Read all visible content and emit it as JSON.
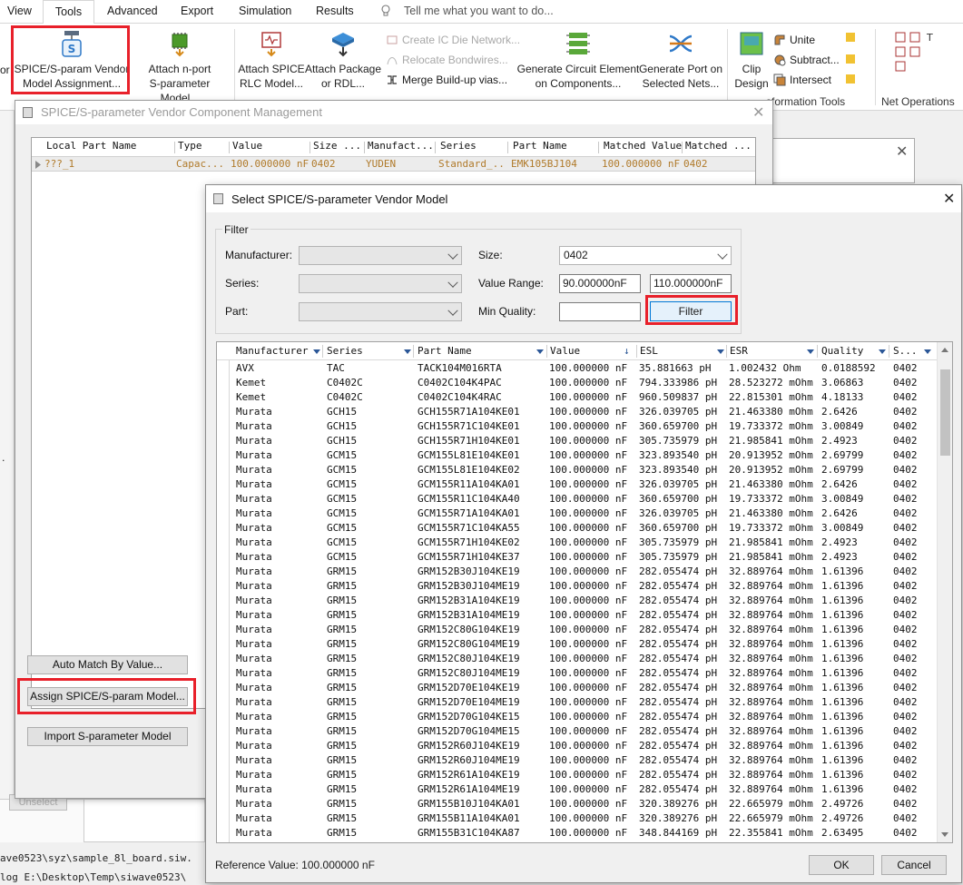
{
  "menubar": {
    "items": [
      "View",
      "Tools",
      "Advanced",
      "Export",
      "Simulation",
      "Results"
    ],
    "active": "Tools",
    "tell_me": "Tell me what you want to do..."
  },
  "ribbon": {
    "spice_vendor": [
      "SPICE/S-param Vendor",
      "Model Assignment..."
    ],
    "attach_nport": [
      "Attach n-port",
      "S-parameter Model..."
    ],
    "attach_spice_rlc": [
      "Attach SPICE",
      "RLC Model..."
    ],
    "attach_package": [
      "Attach Package",
      "or RDL..."
    ],
    "create_ic_die": "Create IC Die Network...",
    "relocate_bondwires": "Relocate Bondwires...",
    "merge_buildup": "Merge Build-up vias...",
    "gen_circuit": [
      "Generate Circuit Element",
      "on Components..."
    ],
    "gen_port": [
      "Generate Port on",
      "Selected Nets..."
    ],
    "clip_design": [
      "Clip",
      "Design"
    ],
    "unite": "Unite",
    "subtract": "Subtract...",
    "intersect": "Intersect",
    "group_transformation": "sformation Tools",
    "group_net_operations": "Net Operations",
    "left_clip": "or"
  },
  "background": {
    "path_line": "ave0523\\syz\\sample_8l_board.siw.",
    "log_line": "log E:\\Desktop\\Temp\\siwave0523\\",
    "unselect": "Unselect"
  },
  "vcm": {
    "title": "SPICE/S-parameter Vendor Component Management",
    "columns": [
      "Local Part Name",
      "Type",
      "Value",
      "Size ...",
      "Manufact...",
      "Series",
      "Part Name",
      "Matched Value",
      "Matched ..."
    ],
    "row": [
      "???_1",
      "Capac...",
      "100.000000 nF",
      "0402",
      "YUDEN",
      "Standard_...",
      "EMK105BJ104",
      "100.000000 nF",
      "0402"
    ],
    "auto_match": "Auto Match By Value...",
    "assign": "Assign SPICE/S-param Model...",
    "import": "Import S-parameter Model"
  },
  "svm": {
    "title": "Select SPICE/S-parameter Vendor Model",
    "filter_legend": "Filter",
    "labels": {
      "manufacturer": "Manufacturer:",
      "series": "Series:",
      "part": "Part:",
      "size": "Size:",
      "value_range": "Value Range:",
      "min_quality": "Min Quality:"
    },
    "size_value": "0402",
    "range_min": "90.000000nF",
    "range_max": "110.000000nF",
    "filter_button": "Filter",
    "columns": [
      "Manufacturer",
      "Series",
      "Part Name",
      "Value",
      "ESL",
      "ESR",
      "Quality",
      "S..."
    ],
    "rows": [
      [
        "AVX",
        "TAC",
        "TACK104M016RTA",
        "100.000000 nF",
        "35.881663 pH",
        "1.002432 Ohm",
        "0.0188592",
        "0402"
      ],
      [
        "Kemet",
        "C0402C",
        "C0402C104K4PAC",
        "100.000000 nF",
        "794.333986 pH",
        "28.523272 mOhm",
        "3.06863",
        "0402"
      ],
      [
        "Kemet",
        "C0402C",
        "C0402C104K4RAC",
        "100.000000 nF",
        "960.509837 pH",
        "22.815301 mOhm",
        "4.18133",
        "0402"
      ],
      [
        "Murata",
        "GCH15",
        "GCH155R71A104KE01",
        "100.000000 nF",
        "326.039705 pH",
        "21.463380 mOhm",
        "2.6426",
        "0402"
      ],
      [
        "Murata",
        "GCH15",
        "GCH155R71C104KE01",
        "100.000000 nF",
        "360.659700 pH",
        "19.733372 mOhm",
        "3.00849",
        "0402"
      ],
      [
        "Murata",
        "GCH15",
        "GCH155R71H104KE01",
        "100.000000 nF",
        "305.735979 pH",
        "21.985841 mOhm",
        "2.4923",
        "0402"
      ],
      [
        "Murata",
        "GCM15",
        "GCM155L81E104KE01",
        "100.000000 nF",
        "323.893540 pH",
        "20.913952 mOhm",
        "2.69799",
        "0402"
      ],
      [
        "Murata",
        "GCM15",
        "GCM155L81E104KE02",
        "100.000000 nF",
        "323.893540 pH",
        "20.913952 mOhm",
        "2.69799",
        "0402"
      ],
      [
        "Murata",
        "GCM15",
        "GCM155R11A104KA01",
        "100.000000 nF",
        "326.039705 pH",
        "21.463380 mOhm",
        "2.6426",
        "0402"
      ],
      [
        "Murata",
        "GCM15",
        "GCM155R11C104KA40",
        "100.000000 nF",
        "360.659700 pH",
        "19.733372 mOhm",
        "3.00849",
        "0402"
      ],
      [
        "Murata",
        "GCM15",
        "GCM155R71A104KA01",
        "100.000000 nF",
        "326.039705 pH",
        "21.463380 mOhm",
        "2.6426",
        "0402"
      ],
      [
        "Murata",
        "GCM15",
        "GCM155R71C104KA55",
        "100.000000 nF",
        "360.659700 pH",
        "19.733372 mOhm",
        "3.00849",
        "0402"
      ],
      [
        "Murata",
        "GCM15",
        "GCM155R71H104KE02",
        "100.000000 nF",
        "305.735979 pH",
        "21.985841 mOhm",
        "2.4923",
        "0402"
      ],
      [
        "Murata",
        "GCM15",
        "GCM155R71H104KE37",
        "100.000000 nF",
        "305.735979 pH",
        "21.985841 mOhm",
        "2.4923",
        "0402"
      ],
      [
        "Murata",
        "GRM15",
        "GRM152B30J104KE19",
        "100.000000 nF",
        "282.055474 pH",
        "32.889764 mOhm",
        "1.61396",
        "0402"
      ],
      [
        "Murata",
        "GRM15",
        "GRM152B30J104ME19",
        "100.000000 nF",
        "282.055474 pH",
        "32.889764 mOhm",
        "1.61396",
        "0402"
      ],
      [
        "Murata",
        "GRM15",
        "GRM152B31A104KE19",
        "100.000000 nF",
        "282.055474 pH",
        "32.889764 mOhm",
        "1.61396",
        "0402"
      ],
      [
        "Murata",
        "GRM15",
        "GRM152B31A104ME19",
        "100.000000 nF",
        "282.055474 pH",
        "32.889764 mOhm",
        "1.61396",
        "0402"
      ],
      [
        "Murata",
        "GRM15",
        "GRM152C80G104KE19",
        "100.000000 nF",
        "282.055474 pH",
        "32.889764 mOhm",
        "1.61396",
        "0402"
      ],
      [
        "Murata",
        "GRM15",
        "GRM152C80G104ME19",
        "100.000000 nF",
        "282.055474 pH",
        "32.889764 mOhm",
        "1.61396",
        "0402"
      ],
      [
        "Murata",
        "GRM15",
        "GRM152C80J104KE19",
        "100.000000 nF",
        "282.055474 pH",
        "32.889764 mOhm",
        "1.61396",
        "0402"
      ],
      [
        "Murata",
        "GRM15",
        "GRM152C80J104ME19",
        "100.000000 nF",
        "282.055474 pH",
        "32.889764 mOhm",
        "1.61396",
        "0402"
      ],
      [
        "Murata",
        "GRM15",
        "GRM152D70E104KE19",
        "100.000000 nF",
        "282.055474 pH",
        "32.889764 mOhm",
        "1.61396",
        "0402"
      ],
      [
        "Murata",
        "GRM15",
        "GRM152D70E104ME19",
        "100.000000 nF",
        "282.055474 pH",
        "32.889764 mOhm",
        "1.61396",
        "0402"
      ],
      [
        "Murata",
        "GRM15",
        "GRM152D70G104KE15",
        "100.000000 nF",
        "282.055474 pH",
        "32.889764 mOhm",
        "1.61396",
        "0402"
      ],
      [
        "Murata",
        "GRM15",
        "GRM152D70G104ME15",
        "100.000000 nF",
        "282.055474 pH",
        "32.889764 mOhm",
        "1.61396",
        "0402"
      ],
      [
        "Murata",
        "GRM15",
        "GRM152R60J104KE19",
        "100.000000 nF",
        "282.055474 pH",
        "32.889764 mOhm",
        "1.61396",
        "0402"
      ],
      [
        "Murata",
        "GRM15",
        "GRM152R60J104ME19",
        "100.000000 nF",
        "282.055474 pH",
        "32.889764 mOhm",
        "1.61396",
        "0402"
      ],
      [
        "Murata",
        "GRM15",
        "GRM152R61A104KE19",
        "100.000000 nF",
        "282.055474 pH",
        "32.889764 mOhm",
        "1.61396",
        "0402"
      ],
      [
        "Murata",
        "GRM15",
        "GRM152R61A104ME19",
        "100.000000 nF",
        "282.055474 pH",
        "32.889764 mOhm",
        "1.61396",
        "0402"
      ],
      [
        "Murata",
        "GRM15",
        "GRM155B10J104KA01",
        "100.000000 nF",
        "320.389276 pH",
        "22.665979 mOhm",
        "2.49726",
        "0402"
      ],
      [
        "Murata",
        "GRM15",
        "GRM155B11A104KA01",
        "100.000000 nF",
        "320.389276 pH",
        "22.665979 mOhm",
        "2.49726",
        "0402"
      ],
      [
        "Murata",
        "GRM15",
        "GRM155B31C104KA87",
        "100.000000 nF",
        "348.844169 pH",
        "22.355841 mOhm",
        "2.63495",
        "0402"
      ]
    ],
    "reference": "Reference Value: 100.000000 nF",
    "ok": "OK",
    "cancel": "Cancel"
  },
  "colors": {
    "highlight_red": "#e8202a",
    "focus_blue": "#0078d7",
    "vcm_row_text": "#b07a2a"
  }
}
